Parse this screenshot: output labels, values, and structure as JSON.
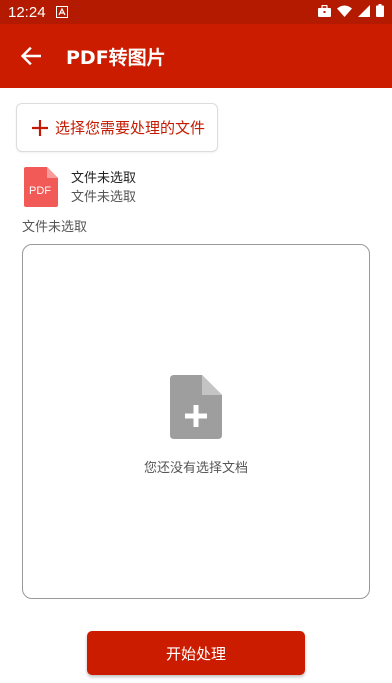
{
  "status_bar": {
    "time": "12:24",
    "left_icon": "app-notification-icon",
    "right_icons": [
      "briefcase-icon",
      "wifi-icon",
      "cellular-signal-icon",
      "battery-icon"
    ]
  },
  "app_bar": {
    "title": "PDF转图片",
    "back_icon": "arrow-back-icon"
  },
  "select_button": {
    "label": "选择您需要处理的文件",
    "icon": "plus-icon"
  },
  "file": {
    "icon_label": "PDF",
    "name": "文件未选取",
    "detail": "文件未选取"
  },
  "status_label": "文件未选取",
  "drop_area": {
    "icon": "document-add-icon",
    "empty_text": "您还没有选择文档"
  },
  "start_button": {
    "label": "开始处理"
  },
  "colors": {
    "status_bar": "#b31a00",
    "primary": "#cc1c00",
    "pdf_icon": "#f25a57"
  }
}
